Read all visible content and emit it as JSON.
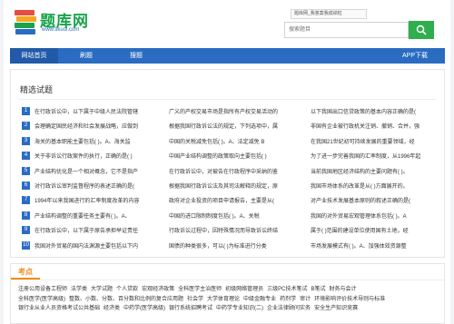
{
  "brand": {
    "name": "题库网",
    "url": "www.tikuol.com"
  },
  "header": {
    "hint": "题库网_我答案我成绩粒",
    "search_placeholder": "搜索题目"
  },
  "nav": {
    "items": [
      "网站首页",
      "刷题",
      "搜题"
    ],
    "app_download": "APP下载"
  },
  "featured": {
    "title": "精选试题",
    "rows": [
      {
        "num": "1",
        "c1": "在行政诉讼中，以下属于中级人民法院管辖",
        "c2": "广义的产权交易市场是指所有产权交易活动的",
        "c3": "以下我国出口信贷政策的基本内容正确的是("
      },
      {
        "num": "2",
        "c1": "会理确定国民经济和社会发展战略，应做到",
        "c2": "根据我国行政诉讼法的规定，下列选项中，属",
        "c3": "非国有企业被行政机关注销、撤销、合并，强"
      },
      {
        "num": "3",
        "c1": "海关的基本职能主要包括( )。A、海关监",
        "c2": "中国的关税减免包括( )。A、法定减免 B",
        "c3": "在我国21世纪初可持续发展的重要领域，经"
      },
      {
        "num": "4",
        "c1": "关于非诉讼行政案件的执行，正确的是( )",
        "c2": "中国产业结构调整的政策取向主要包括( )",
        "c3": "为了进一步完善我国的汇率制度，从1996年起"
      },
      {
        "num": "5",
        "c1": "产业结构优化是一个相对概念，它不是指产",
        "c2": "在行政诉讼中，对被告在行政程序中采纳的鉴",
        "c3": "当前我国地区经济结构的主要问题有( )。"
      },
      {
        "num": "6",
        "c1": "对行政诉讼审判监督程序的表述正确的是(",
        "c2": "根据我国行政诉讼法及其司法解释的规定，原",
        "c3": "我国市场体系的改革是从( )方面展开的。"
      },
      {
        "num": "7",
        "c1": "1994年以来我国进行的汇率制度改革的内容",
        "c2": "政府对企业投资的项目申请报告，主要是从(",
        "c3": "对产业技术发展基本原则的叙述正确的是("
      },
      {
        "num": "8",
        "c1": "产业结构调整的重要任务主要有( )。A、",
        "c2": "中国的进口限制制度包括( )。A、关税",
        "c3": "我国的对外贸易宏观管理体系包括( )。A"
      },
      {
        "num": "9",
        "c1": "在行政诉讼中，以下属于原告承担举证责任",
        "c2": "行政诉讼过程中，因特殊情况而导致诉讼终结",
        "c3": "属于( )范围的建设单位使用国有土地，经"
      },
      {
        "num": "10",
        "c1": "我国对外贸易的国内法渊源主要包括以下内",
        "c2": "国债的种类很多，可以( )为标准进行分类",
        "c3": "市场发展模式有( )。A、加强体效资源整"
      }
    ]
  },
  "keypoints": {
    "title": "考点",
    "lines": [
      [
        "注册公用设备工程师",
        "法学类",
        "大学试题",
        "个人贷款",
        "宏观经济政策",
        "全科医学主治医师",
        "初级网络管理员",
        "三级PC技术笔试",
        "B笔试",
        "财务与会计"
      ],
      [
        "全科医学(医学高级)",
        "整数、小数、分数、百分数和比例的复合应用题",
        "社会学",
        "大学体育理论",
        "中级金融专业",
        "药剂学",
        "审计",
        "环境影响评价技术导则与标准"
      ],
      [
        "银行业从业人员资格考试公共基础",
        "经济类",
        "中药学(医学高级)",
        "银行系统招聘考试",
        "中药学专业知识(二)",
        "企业法律顾问实务",
        "安全生产知识竞赛"
      ]
    ]
  },
  "colors": {
    "brand_green": "#1aa34a",
    "nav_blue": "#2a6cc1",
    "accent_orange": "#f28c1a"
  }
}
